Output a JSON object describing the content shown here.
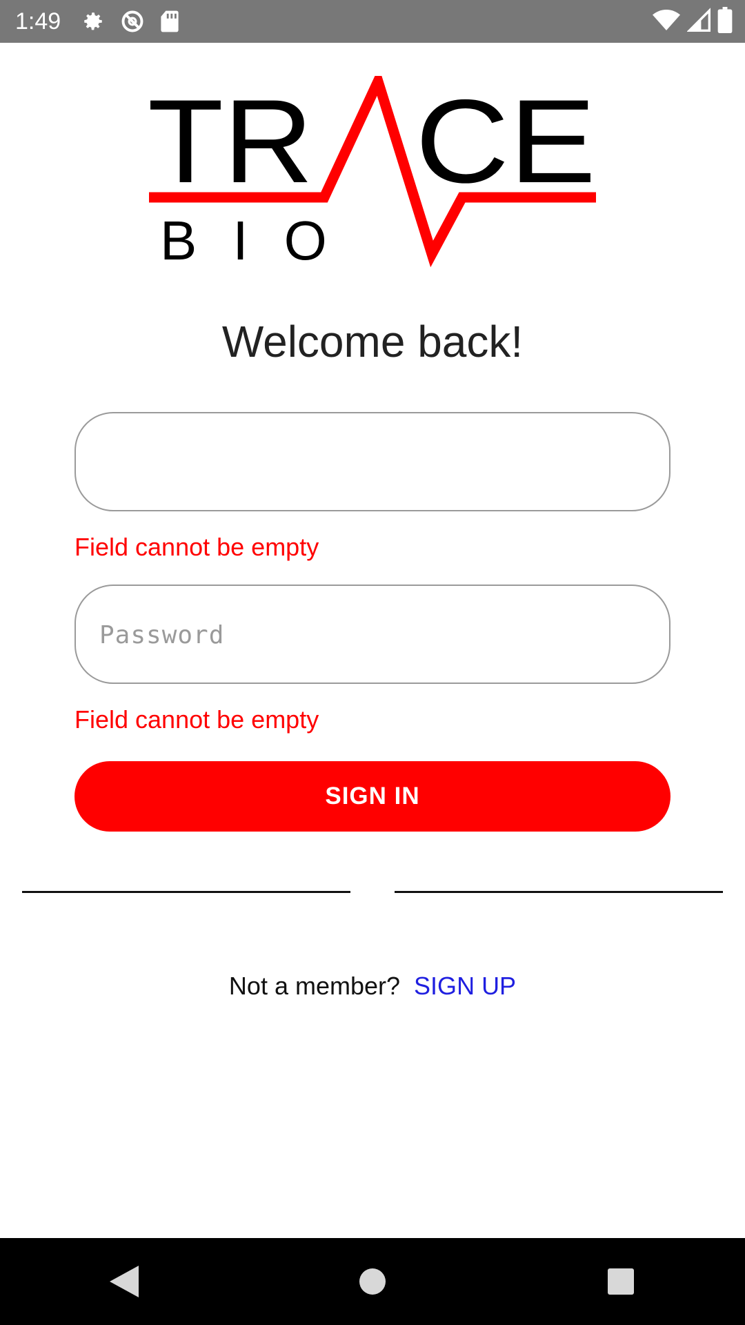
{
  "status_bar": {
    "time": "1:49",
    "left_icons": [
      "gear-icon",
      "no-disturb-icon",
      "sd-card-icon"
    ],
    "right_icons": [
      "wifi-icon",
      "signal-icon",
      "battery-icon"
    ]
  },
  "logo": {
    "word": "TRACE",
    "sub": "BIO",
    "accent_color": "#ff0000"
  },
  "welcome_text": "Welcome back!",
  "form": {
    "username": {
      "value": "",
      "placeholder": "",
      "error": "Field cannot be empty"
    },
    "password": {
      "value": "",
      "placeholder": "Password",
      "error": "Field cannot be empty"
    },
    "sign_in_label": "SIGN IN"
  },
  "footer": {
    "prompt": "Not a member?",
    "signup_label": "SIGN UP"
  },
  "nav_bar": {
    "buttons": [
      "back-icon",
      "home-icon",
      "recents-icon"
    ]
  },
  "colors": {
    "primary": "#ff0000",
    "link": "#1f1fe0",
    "status_bar": "#787878"
  }
}
